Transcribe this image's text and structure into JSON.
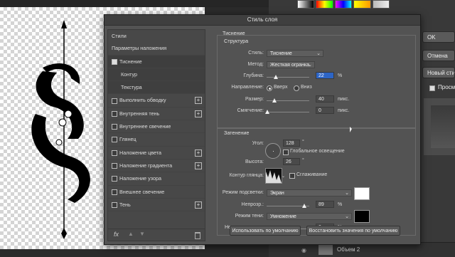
{
  "dialog": {
    "title": "Стиль слоя"
  },
  "left_panel": {
    "header": "Стили",
    "blending": "Параметры наложения",
    "items": [
      {
        "label": "Тиснение",
        "checked": true,
        "selected": true,
        "plus": false
      },
      {
        "label": "Контур",
        "sub": true
      },
      {
        "label": "Текстура",
        "sub": true
      },
      {
        "label": "Выполнить обводку",
        "checked": false,
        "plus": true
      },
      {
        "label": "Внутренняя тень",
        "checked": false,
        "plus": true
      },
      {
        "label": "Внутреннее свечение",
        "checked": false,
        "plus": false
      },
      {
        "label": "Глянец",
        "checked": false,
        "plus": false
      },
      {
        "label": "Наложение цвета",
        "checked": false,
        "plus": true
      },
      {
        "label": "Наложение градиента",
        "checked": false,
        "plus": true
      },
      {
        "label": "Наложение узора",
        "checked": false,
        "plus": false
      },
      {
        "label": "Внешнее свечение",
        "checked": false,
        "plus": false
      },
      {
        "label": "Тень",
        "checked": false,
        "plus": true
      }
    ],
    "footer_fx": "fx"
  },
  "bevel": {
    "section": "Тиснение",
    "structure": "Структура",
    "style_label": "Стиль:",
    "style_value": "Тиснение",
    "method_label": "Метод:",
    "method_value": "Жесткая огранка",
    "depth_label": "Глубина:",
    "depth_value": "22",
    "depth_unit": "%",
    "depth_fraction": 0.22,
    "direction_label": "Направление:",
    "dir_up": "Вверх",
    "dir_down": "Вниз",
    "size_label": "Размер:",
    "size_value": "40",
    "size_unit": "пикс.",
    "soften_label": "Смягчение:",
    "soften_value": "0",
    "soften_unit": "пикс."
  },
  "shading": {
    "section": "Затенение",
    "angle_label": "Угол:",
    "angle_value": "128",
    "angle_unit": "°",
    "global_light": "Глобальное освещение",
    "altitude_label": "Высота:",
    "altitude_value": "26",
    "altitude_unit": "°",
    "gloss_label": "Контур глянца:",
    "antialias": "Сглаживание",
    "highlight_label": "Режим подсветки:",
    "highlight_value": "Экран",
    "highlight_color": "#ffffff",
    "opacity1_label": "Непрозр.:",
    "opacity1_value": "89",
    "opacity1_unit": "%",
    "shadow_label": "Режим тени:",
    "shadow_value": "Умножение",
    "shadow_color": "#000000",
    "opacity2_label": "Непрозрачность:",
    "opacity2_value": "0",
    "opacity2_unit": "%"
  },
  "buttons": {
    "default": "Использовать по умолчанию",
    "reset": "Восстановить значения по умолчанию"
  },
  "right": {
    "ok": "OK",
    "cancel": "Отмена",
    "new_style": "Новый стиль...",
    "preview": "Просмотр"
  },
  "layers": {
    "layer_name": "Объем 2"
  }
}
